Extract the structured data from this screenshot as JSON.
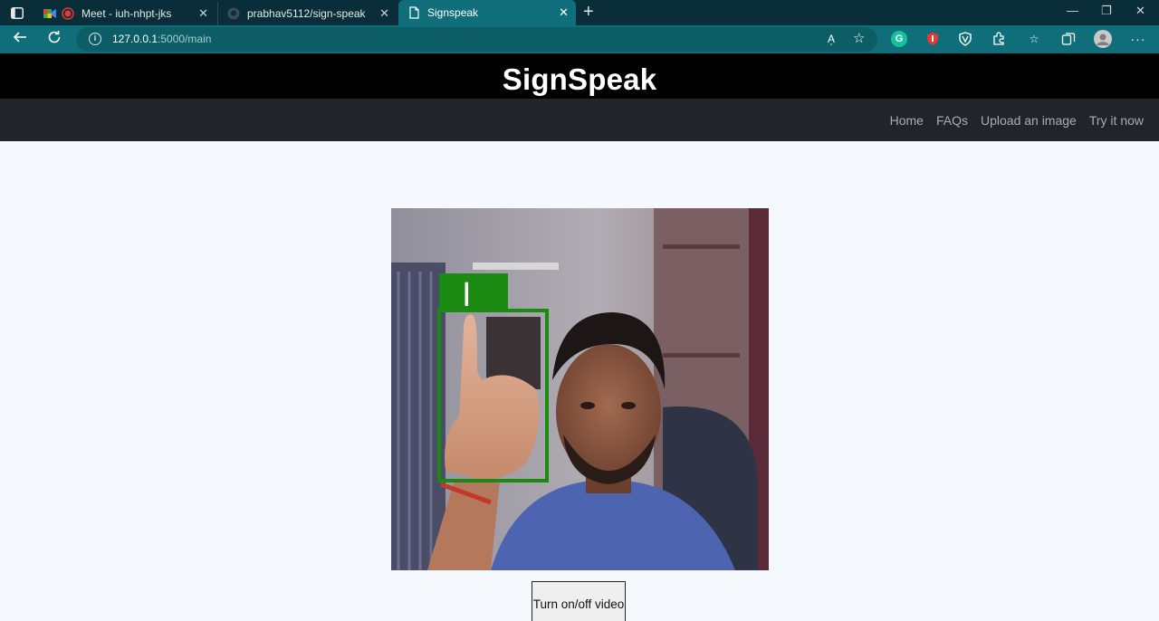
{
  "browser": {
    "tabs": [
      {
        "title": "Meet - iuh-nhpt-jks",
        "active": false
      },
      {
        "title": "prabhav5112/sign-speak",
        "active": false
      },
      {
        "title": "Signspeak",
        "active": true
      }
    ],
    "url_host": "127.0.0.1",
    "url_path": ":5000/main",
    "reader_label": "A̩"
  },
  "site": {
    "title": "SignSpeak",
    "nav": [
      "Home",
      "FAQs",
      "Upload an image",
      "Try it now"
    ]
  },
  "video": {
    "detected_sign": "I",
    "box_color": "#1b8a12"
  },
  "controls": {
    "toggle_label": "Turn on/off video"
  }
}
